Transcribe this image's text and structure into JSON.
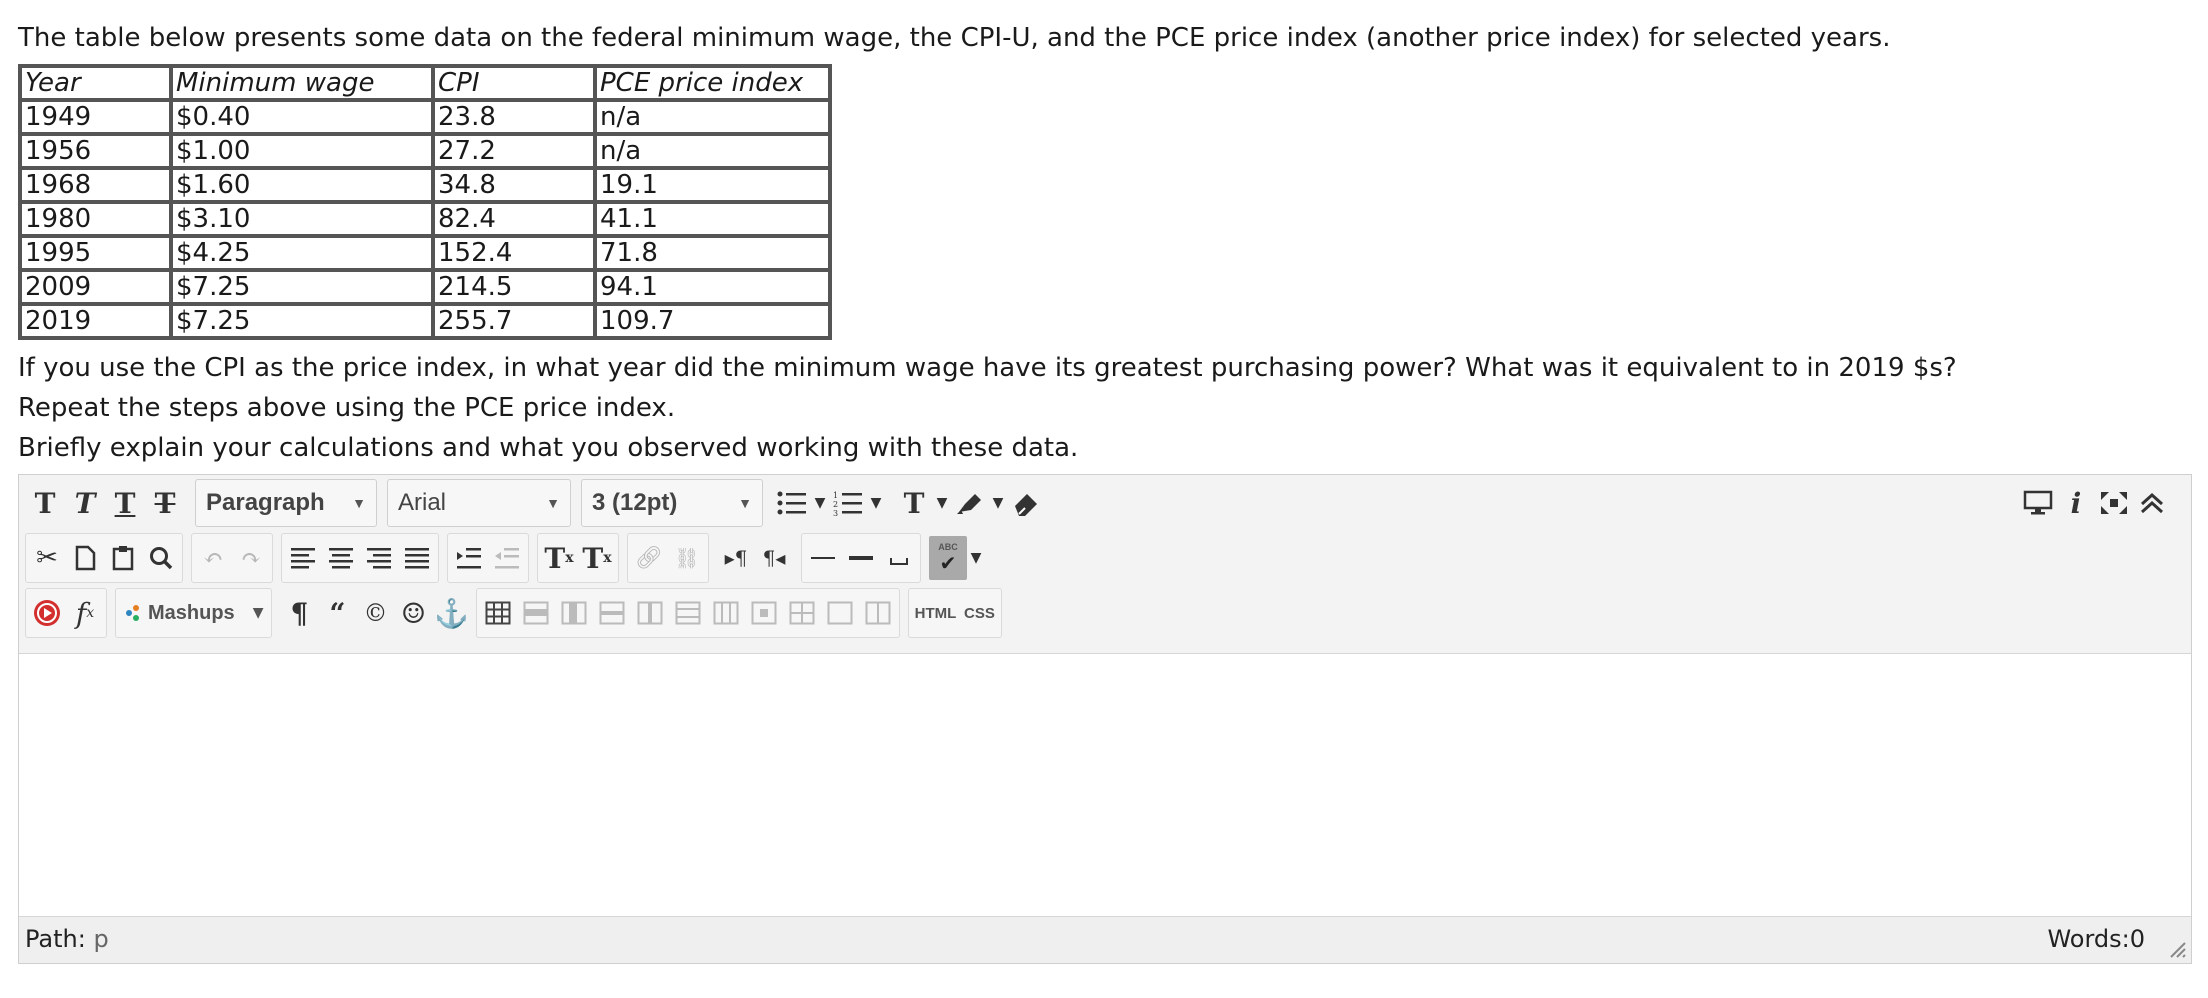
{
  "intro": "The table below presents some data on the federal minimum wage, the CPI-U, and the PCE price index (another price index) for selected years.",
  "table": {
    "headers": [
      "Year",
      "Minimum wage",
      "CPI",
      "PCE price index"
    ],
    "rows": [
      [
        "1949",
        "$0.40",
        "23.8",
        "n/a"
      ],
      [
        "1956",
        "$1.00",
        "27.2",
        "n/a"
      ],
      [
        "1968",
        "$1.60",
        "34.8",
        "19.1"
      ],
      [
        "1980",
        "$3.10",
        "82.4",
        "41.1"
      ],
      [
        "1995",
        "$4.25",
        "152.4",
        "71.8"
      ],
      [
        "2009",
        "$7.25",
        "214.5",
        "94.1"
      ],
      [
        "2019",
        "$7.25",
        "255.7",
        "109.7"
      ]
    ]
  },
  "questions": [
    "If you use the CPI as the price index, in what year did the minimum wage have its greatest purchasing power? What was it equivalent to in 2019 $s?",
    "Repeat the steps above using the PCE price index.",
    "Briefly explain your calculations and what you observed working with these data."
  ],
  "editor": {
    "format_select": "Paragraph",
    "font_select": "Arial",
    "size_select": "3 (12pt)",
    "mashups_label": "Mashups",
    "html_label": "HTML",
    "css_label": "CSS",
    "spell_label": "ABC",
    "path_label": "Path:",
    "path_value": "p",
    "word_count": "Words:0",
    "icons": [
      "bold-icon",
      "italic-icon",
      "underline-icon",
      "strikethrough-icon",
      "bullet-list-icon",
      "numbered-list-icon",
      "text-color-icon",
      "highlight-icon",
      "clear-format-icon",
      "preview-icon",
      "info-icon",
      "fullscreen-icon",
      "collapse-icon",
      "cut-icon",
      "copy-icon",
      "paste-icon",
      "find-icon",
      "undo-icon",
      "redo-icon",
      "align-left-icon",
      "align-center-icon",
      "align-right-icon",
      "justify-icon",
      "indent-icon",
      "outdent-icon",
      "superscript-icon",
      "subscript-icon",
      "link-icon",
      "unlink-icon",
      "ltr-icon",
      "rtl-icon",
      "horizontal-rule-icon",
      "thick-rule-icon",
      "nonbreaking-space-icon",
      "spellcheck-icon",
      "record-icon",
      "formula-icon",
      "paragraph-mark-icon",
      "quote-icon",
      "copyright-icon",
      "emoji-icon",
      "anchor-icon",
      "table-icon",
      "html-icon",
      "css-icon"
    ]
  }
}
